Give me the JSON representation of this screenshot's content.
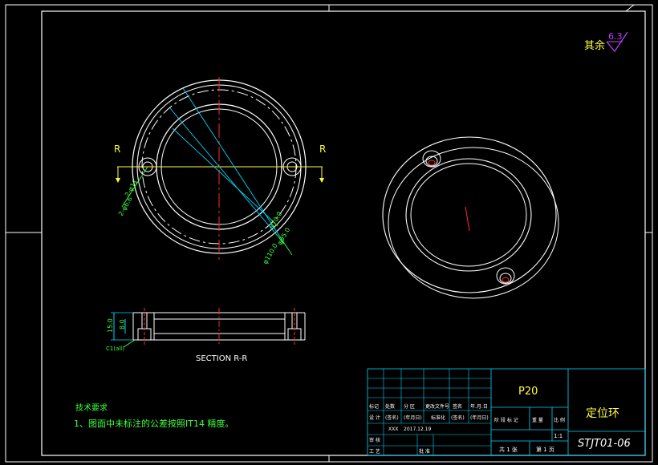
{
  "surface_finish": {
    "prefix": "其余",
    "value": "6.3"
  },
  "front_view": {
    "section_mark_left": "R",
    "section_mark_right": "R",
    "dims": [
      "φ70.0",
      "φ95.0",
      "φ110.0"
    ],
    "hole_callout_a": "2-φ11",
    "hole_callout_b": "2-φ6.6"
  },
  "section_view": {
    "title": "SECTION R-R",
    "dim_thickness": "15.0",
    "dim_step": "8.0",
    "chamfer": "C1(all)"
  },
  "tech_requirements": {
    "title": "技术要求",
    "item1": "1、图面中未标注的公差按照IT14 精度。"
  },
  "title_block": {
    "material": "P20",
    "part_name": "定位环",
    "drawing_no": "STJT01-06",
    "scale": "1:1",
    "sheet_total": "共 1 张",
    "sheet_no": "第 1 页",
    "row_headers": [
      "标记",
      "处数",
      "分 区",
      "更改文件号",
      "签名",
      "年.月.日"
    ],
    "design_row": [
      "设 计",
      "(签名)",
      "(年月日)",
      "标准化",
      "(签名)",
      "(年月日)"
    ],
    "designer": "XXX",
    "date": "2017.12.19",
    "stage_headers": [
      "阶 段 标 记",
      "重 量",
      "比 例"
    ],
    "review_label": "审 核",
    "process_label": "工 艺",
    "approve_label": "批 准"
  },
  "colors": {
    "bg": "#000000",
    "line": "#ffffff",
    "center": "#ff2b2b",
    "dim": "#00d8ff",
    "hole_dim": "#3cff3c",
    "text_green": "#3cff3c",
    "text_yellow": "#ffff3c",
    "symbol": "#c040ff",
    "frame": "#ffffff"
  }
}
